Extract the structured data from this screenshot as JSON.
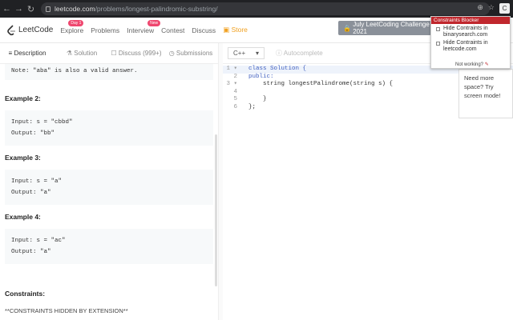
{
  "browser": {
    "url_host": "leetcode.com",
    "url_path": "/problems/longest-palindromic-substring/"
  },
  "nav": {
    "logo": "LeetCode",
    "items": [
      {
        "label": "Explore",
        "badge": "Day 1"
      },
      {
        "label": "Problems",
        "badge": ""
      },
      {
        "label": "Interview",
        "badge": "New"
      },
      {
        "label": "Contest",
        "badge": ""
      },
      {
        "label": "Discuss",
        "badge": ""
      },
      {
        "label": "Store",
        "badge": ""
      }
    ],
    "challenge": "July LeetCoding Challenge 2021"
  },
  "tabs": [
    "Description",
    "Solution",
    "Discuss (999+)",
    "Submissions"
  ],
  "description": {
    "note": "Note: \"aba\" is also a valid answer.",
    "examples": [
      {
        "title": "Example 2:",
        "input": "Input: s = \"cbbd\"",
        "output": "Output: \"bb\""
      },
      {
        "title": "Example 3:",
        "input": "Input: s = \"a\"",
        "output": "Output: \"a\""
      },
      {
        "title": "Example 4:",
        "input": "Input: s = \"ac\"",
        "output": "Output: \"a\""
      }
    ],
    "constraints_title": "Constraints:",
    "constraints_text": "**CONSTRAINTS HIDDEN BY EXTENSION**"
  },
  "editor": {
    "language": "C++",
    "autocomplete": "Autocomplete",
    "lines": [
      "class Solution {",
      "public:",
      "    string longestPalindrome(string s) {",
      "",
      "    }",
      "};"
    ]
  },
  "extension": {
    "title": "Constraints Blocker",
    "options": [
      "Hide Contraints in binarysearch.com",
      "Hide Contraints in leetcode.com"
    ],
    "footer": "Not working?"
  },
  "tooltip": "Need more space? Try screen mode!"
}
